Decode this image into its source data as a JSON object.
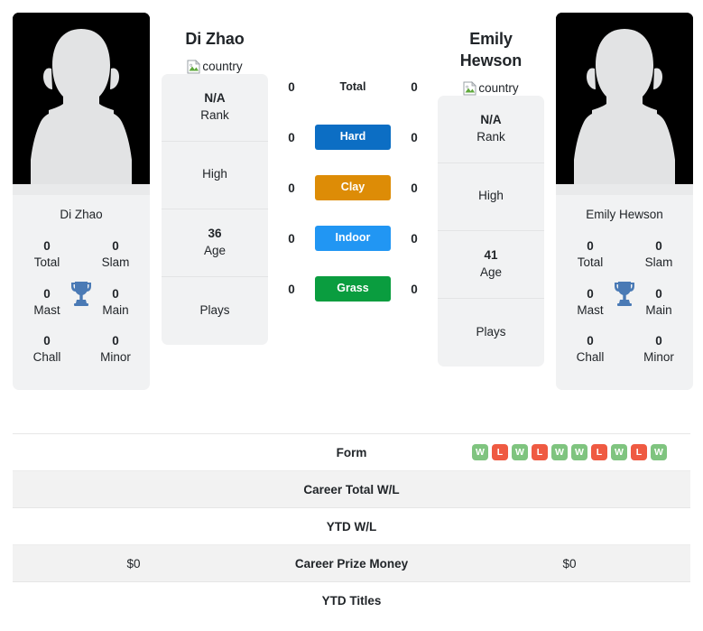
{
  "players": {
    "left": {
      "name": "Di Zhao",
      "card_name": "Di Zhao",
      "country_alt": "country",
      "rank_value": "N/A",
      "rank_label": "Rank",
      "high_value": "",
      "high_label": "High",
      "age_value": "36",
      "age_label": "Age",
      "plays_value": "",
      "plays_label": "Plays",
      "titles": [
        {
          "value": "0",
          "label": "Total"
        },
        {
          "value": "0",
          "label": "Slam"
        },
        {
          "value": "0",
          "label": "Mast"
        },
        {
          "value": "0",
          "label": "Main"
        },
        {
          "value": "0",
          "label": "Chall"
        },
        {
          "value": "0",
          "label": "Minor"
        }
      ]
    },
    "right": {
      "name": "Emily Hewson",
      "card_name": "Emily Hewson",
      "country_alt": "country",
      "rank_value": "N/A",
      "rank_label": "Rank",
      "high_value": "",
      "high_label": "High",
      "age_value": "41",
      "age_label": "Age",
      "plays_value": "",
      "plays_label": "Plays",
      "titles": [
        {
          "value": "0",
          "label": "Total"
        },
        {
          "value": "0",
          "label": "Slam"
        },
        {
          "value": "0",
          "label": "Mast"
        },
        {
          "value": "0",
          "label": "Main"
        },
        {
          "value": "0",
          "label": "Chall"
        },
        {
          "value": "0",
          "label": "Minor"
        }
      ]
    }
  },
  "head_to_head": [
    {
      "label": "Total",
      "left": "0",
      "right": "0",
      "style": "plain",
      "color": ""
    },
    {
      "label": "Hard",
      "left": "0",
      "right": "0",
      "style": "badge",
      "color": "#0c6ec4"
    },
    {
      "label": "Clay",
      "left": "0",
      "right": "0",
      "style": "badge",
      "color": "#dd8c06"
    },
    {
      "label": "Indoor",
      "left": "0",
      "right": "0",
      "style": "badge",
      "color": "#2196f3"
    },
    {
      "label": "Grass",
      "left": "0",
      "right": "0",
      "style": "badge",
      "color": "#0a9d3f"
    }
  ],
  "comparison_table": [
    {
      "label": "Form",
      "left": "",
      "right": "",
      "type": "form",
      "striped": false
    },
    {
      "label": "Career Total W/L",
      "left": "",
      "right": "",
      "type": "text",
      "striped": true
    },
    {
      "label": "YTD W/L",
      "left": "",
      "right": "",
      "type": "text",
      "striped": false
    },
    {
      "label": "Career Prize Money",
      "left": "$0",
      "right": "$0",
      "type": "text",
      "striped": true
    },
    {
      "label": "YTD Titles",
      "left": "",
      "right": "",
      "type": "text",
      "striped": false
    }
  ],
  "form": {
    "right_results": [
      "W",
      "L",
      "W",
      "L",
      "W",
      "W",
      "L",
      "W",
      "L",
      "W"
    ],
    "left_results": []
  },
  "colors": {
    "win": "#7fc47f",
    "loss": "#ef5a42",
    "card_bg": "#f1f2f3",
    "stripe_bg": "#f2f2f2",
    "trophy": "#4a7ab5",
    "avatar_bg": "#000000",
    "avatar_figure": "#e2e3e4"
  },
  "icons": {
    "trophy": "trophy-icon",
    "broken_image": "broken-image-icon",
    "avatar": "person-silhouette-icon"
  }
}
